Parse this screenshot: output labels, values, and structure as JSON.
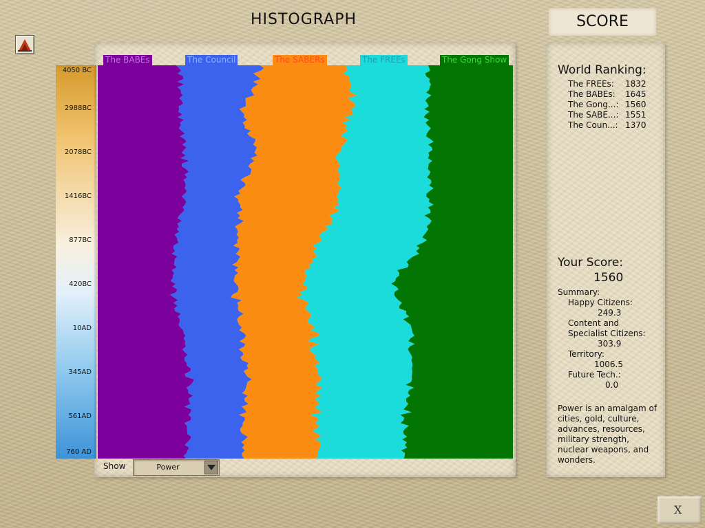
{
  "header": {
    "histograph_title": "HISTOGRAPH",
    "score_title": "SCORE"
  },
  "timeline": [
    "4050 BC",
    "2988BC",
    "2078BC",
    "1416BC",
    "877BC",
    "420BC",
    "10AD",
    "345AD",
    "561AD",
    "760 AD"
  ],
  "civilizations": [
    {
      "name": "The BABEs",
      "color": "#7b009c",
      "label_color": "#b64cd8"
    },
    {
      "name": "The Council",
      "color": "#3b63ee",
      "label_color": "#5c86ff"
    },
    {
      "name": "The SABERs",
      "color": "#fb8c12",
      "label_color": "#fb5a12"
    },
    {
      "name": "The FREEs",
      "color": "#1bdbdb",
      "label_color": "#26b6c6"
    },
    {
      "name": "The Gong Show",
      "color": "#037503",
      "label_color": "#1aa51a"
    }
  ],
  "chart_data": {
    "type": "area",
    "stacked": "100%",
    "metric": "Power",
    "time_labels": [
      "4050 BC",
      "2988BC",
      "2078BC",
      "1416BC",
      "877BC",
      "420BC",
      "10AD",
      "345AD",
      "561AD",
      "760 AD"
    ],
    "series": [
      {
        "name": "The BABEs",
        "values": [
          20,
          20,
          21,
          21,
          19,
          18,
          20,
          22,
          22,
          21
        ]
      },
      {
        "name": "The Council",
        "values": [
          20,
          15,
          17,
          13,
          15,
          15,
          14,
          14,
          13,
          14
        ]
      },
      {
        "name": "The SABERs",
        "values": [
          20,
          26,
          20,
          24,
          20,
          16,
          17,
          17,
          18,
          18
        ]
      },
      {
        "name": "The FREEs",
        "values": [
          20,
          18,
          22,
          22,
          25,
          22,
          24,
          23,
          21,
          21
        ]
      },
      {
        "name": "The Gong Show",
        "values": [
          20,
          21,
          20,
          20,
          21,
          29,
          25,
          24,
          26,
          26
        ]
      }
    ]
  },
  "show": {
    "label": "Show",
    "value": "Power"
  },
  "world_ranking": {
    "title": "World Ranking:",
    "rows": [
      {
        "name": "The FREEs:",
        "score": "1832"
      },
      {
        "name": "The BABEs:",
        "score": "1645"
      },
      {
        "name": "The Gong...:",
        "score": "1560"
      },
      {
        "name": "The SABE...:",
        "score": "1551"
      },
      {
        "name": "The Coun...:",
        "score": "1370"
      }
    ]
  },
  "your_score": {
    "title": "Your Score:",
    "value": "1560",
    "summary_label": "Summary:",
    "happy_label": "Happy Citizens:",
    "happy_value": "249.3",
    "content_label_1": "Content and",
    "content_label_2": "Specialist Citizens:",
    "content_value": "303.9",
    "territory_label": "Territory:",
    "territory_value": "1006.5",
    "future_label": "Future Tech.:",
    "future_value": "0.0"
  },
  "power_description": "Power is an amalgam of cities, gold, culture, advances, resources, military strength, nuclear weapons, and wonders.",
  "close_label": "X"
}
